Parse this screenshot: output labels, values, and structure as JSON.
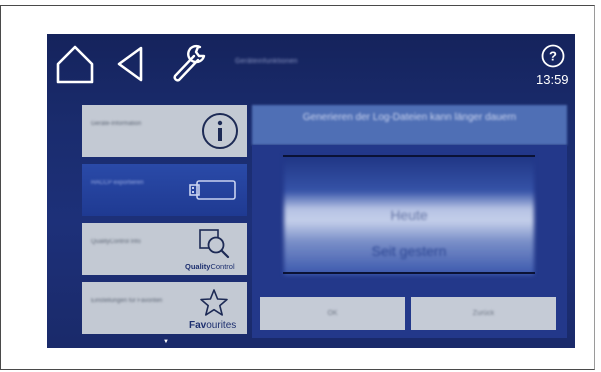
{
  "topbar": {
    "title": "Geräteinfunktionen",
    "time": "13:59",
    "help_label": "?"
  },
  "menu": {
    "items": [
      {
        "label": "Geräte-Information",
        "icon": "info-icon"
      },
      {
        "label": "HACCP exportieren",
        "icon": "usb-stick-icon"
      },
      {
        "label": "QualityControl Info",
        "icon": "magnifier-icon",
        "brand_bold": "Quality",
        "brand_light": "Control"
      },
      {
        "label": "Einstellungen für Favoriten",
        "icon": "star-icon",
        "brand_bold": "Fav",
        "brand_light": "ourites"
      }
    ],
    "scroll_indicator": "▼"
  },
  "dialog": {
    "header": "Generieren der Log-Dateien kann länger dauern",
    "options": [
      "Heute",
      "Seit gestern"
    ],
    "selected": "Heute",
    "ok_label": "OK",
    "back_label": "Zurück"
  },
  "colors": {
    "background": "#1d3079",
    "menu_item": "#c3c9d3",
    "accent": "#2a4aa8",
    "dialog_header": "#4f6fb5"
  }
}
